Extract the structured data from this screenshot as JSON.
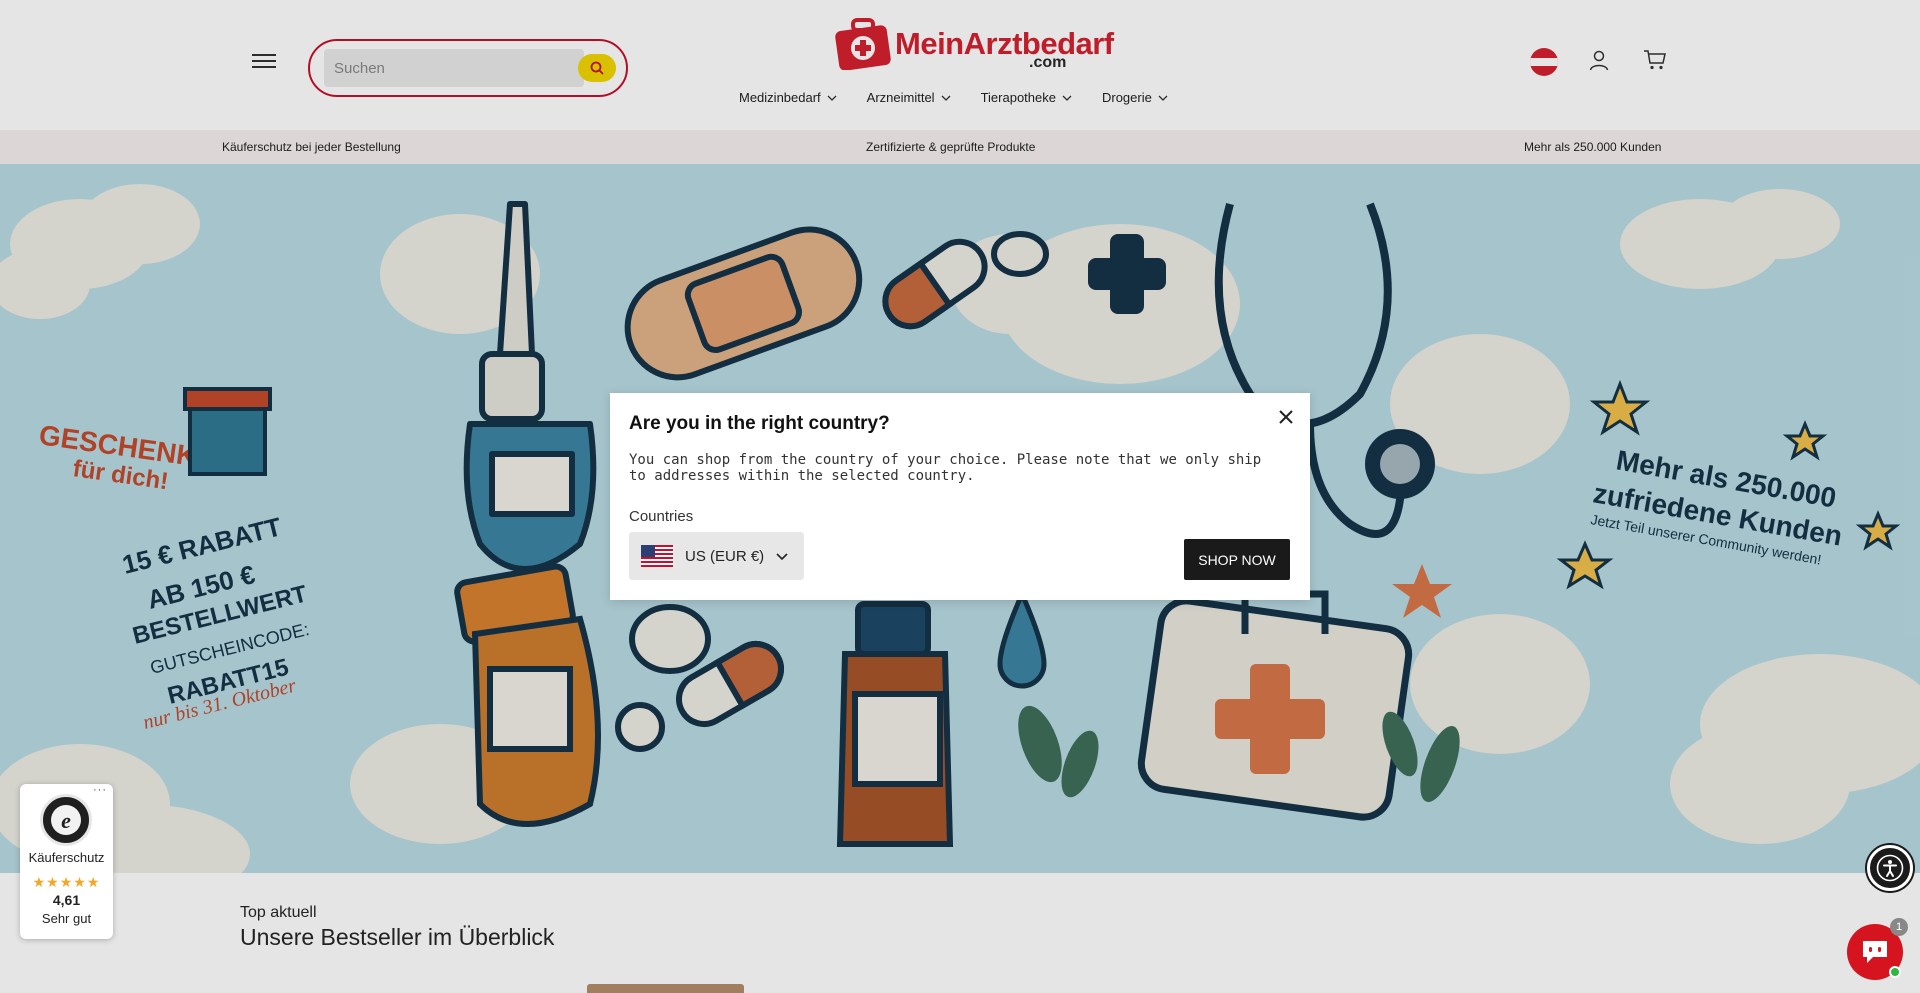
{
  "header": {
    "search_placeholder": "Suchen",
    "logo_main": "MeinArztbedarf",
    "logo_tld": ".com",
    "nav": [
      {
        "label": "Medizinbedarf"
      },
      {
        "label": "Arzneimittel"
      },
      {
        "label": "Tierapotheke"
      },
      {
        "label": "Drogerie"
      }
    ],
    "accent_color": "#d62130"
  },
  "benefits": [
    {
      "icon": "box-icon",
      "text": " Käuferschutz bei jeder Bestellung"
    },
    {
      "icon": "box-icon",
      "text": " Zertifizierte & geprüfte Produkte"
    },
    {
      "icon": "box-icon",
      "text": " Mehr als 250.000 Kunden"
    }
  ],
  "hero": {
    "left_promo": {
      "headline_1": "GESCHENK",
      "headline_2": "für dich!",
      "offer_1": "15 € RABATT",
      "offer_2": "AB 150 €",
      "offer_3": "BESTELLWERT",
      "code_label": "GUTSCHEINCODE:",
      "code": "RABATT15",
      "deadline": "nur bis 31. Oktober"
    },
    "right_promo": {
      "line_1": "Mehr als 250.000",
      "line_2": "zufriedene Kunden",
      "line_3": "Jetzt Teil unserer Community werden!"
    }
  },
  "modal": {
    "title": "Are you in the right country?",
    "text": "You can shop from the country of your choice. Please note that we only ship to addresses within the selected country.",
    "countries_label": "Countries",
    "selected_country": "US (EUR €)",
    "shop_button": "SHOP NOW"
  },
  "section": {
    "subtitle": "Top aktuell",
    "title": "Unsere Bestseller im Überblick"
  },
  "trusted_shops": {
    "more": "···",
    "label": "Käuferschutz",
    "stars": "★★★★★",
    "rating": "4,61",
    "rating_text": "Sehr gut"
  },
  "chat": {
    "badge_count": "1"
  }
}
